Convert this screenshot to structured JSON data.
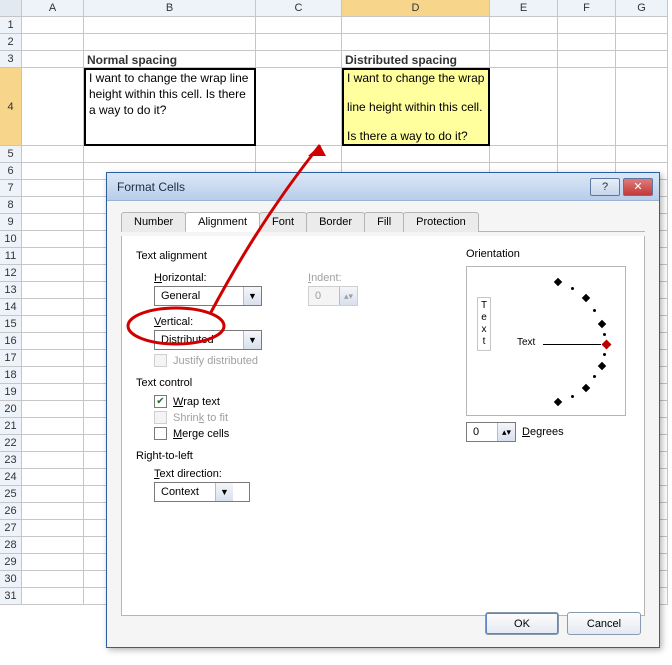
{
  "columns": [
    "A",
    "B",
    "C",
    "D",
    "E",
    "F",
    "G"
  ],
  "rows": [
    "1",
    "2",
    "3",
    "4",
    "5",
    "6",
    "7",
    "8",
    "9",
    "10",
    "11",
    "12",
    "13",
    "14",
    "15",
    "16",
    "17",
    "18",
    "19",
    "20",
    "21",
    "22",
    "23",
    "24",
    "25",
    "26",
    "27",
    "28",
    "29",
    "30",
    "31"
  ],
  "spreadsheet": {
    "b3": "Normal spacing",
    "d3": "Distributed spacing",
    "b4": "I want to change the wrap line height within this cell. Is there a way to do it?",
    "d4_l1": "I want to change the wrap",
    "d4_l2": "line height within this cell.",
    "d4_l3": "Is there a way to do it?"
  },
  "dialog": {
    "title": "Format Cells",
    "help_icon": "?",
    "close_icon": "✕",
    "tabs": [
      "Number",
      "Alignment",
      "Font",
      "Border",
      "Fill",
      "Protection"
    ],
    "active_tab": 1,
    "text_alignment_label": "Text alignment",
    "horizontal_label": "Horizontal:",
    "horizontal_value": "General",
    "indent_label": "Indent:",
    "indent_value": "0",
    "vertical_label": "Vertical:",
    "vertical_value": "Distributed",
    "justify_dist_label": "Justify distributed",
    "text_control_label": "Text control",
    "wrap_label": "Wrap text",
    "shrink_label": "Shrink to fit",
    "merge_label": "Merge cells",
    "rtl_label": "Right-to-left",
    "text_dir_label": "Text direction:",
    "text_dir_value": "Context",
    "orientation_label": "Orientation",
    "orient_text_vert": "Text",
    "orient_text_horiz": "Text",
    "degrees_value": "0",
    "degrees_label": "Degrees",
    "ok": "OK",
    "cancel": "Cancel"
  }
}
